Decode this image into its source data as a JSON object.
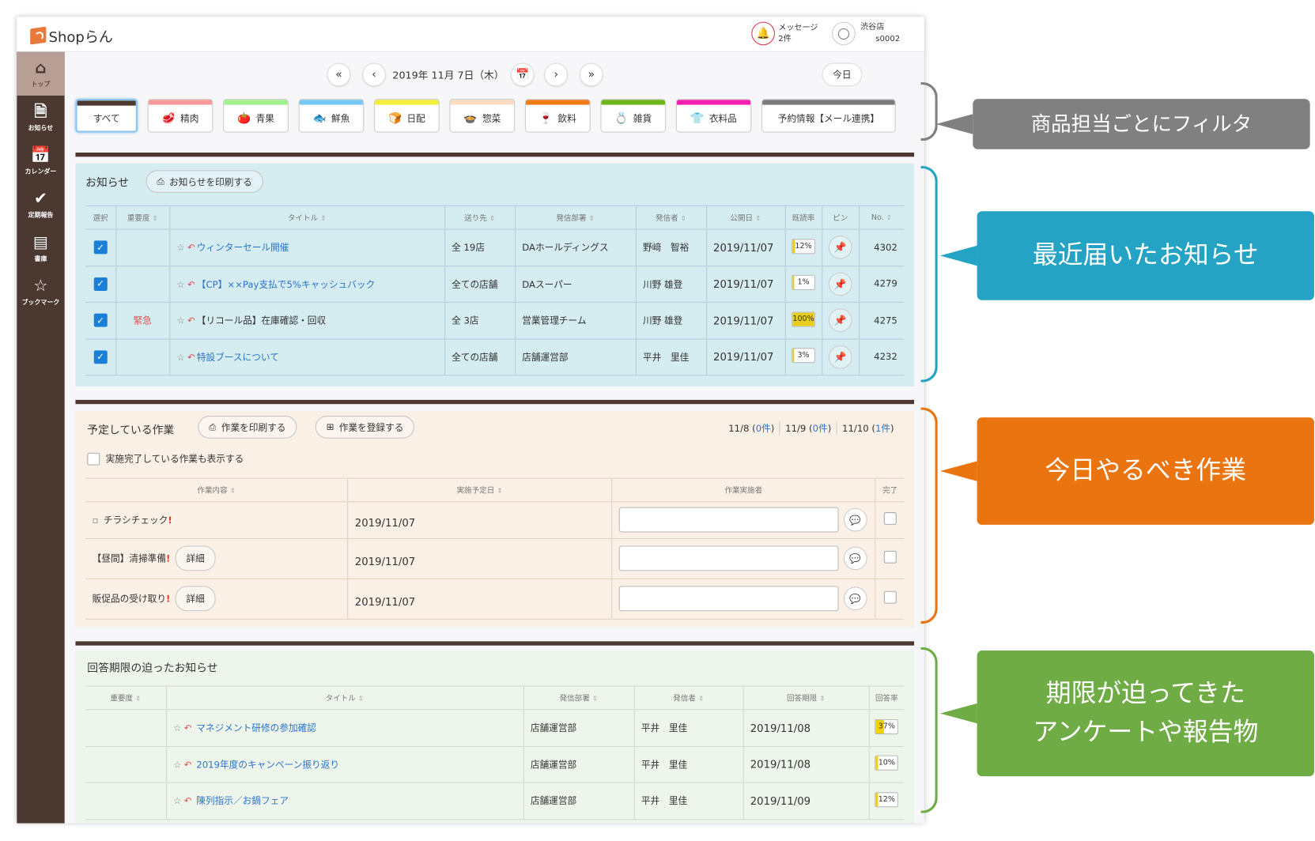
{
  "app": {
    "logo": "Shopらん",
    "message_label": "メッセージ",
    "message_count": "2件",
    "store_name": "渋谷店",
    "store_code": "s0002"
  },
  "sidebar": {
    "items": [
      {
        "label": "トップ",
        "icon": "home-icon"
      },
      {
        "label": "お知らせ",
        "icon": "document-icon"
      },
      {
        "label": "カレンダー",
        "icon": "calendar-icon"
      },
      {
        "label": "定期報告",
        "icon": "check-icon"
      },
      {
        "label": "書庫",
        "icon": "book-icon"
      },
      {
        "label": "ブックマーク",
        "icon": "star-icon"
      }
    ]
  },
  "datenav": {
    "date": "2019年 11月 7日（木）",
    "today": "今日"
  },
  "filters": [
    {
      "label": "すべて",
      "color": "#4a3831",
      "emoji": ""
    },
    {
      "label": "精肉",
      "color": "#f99a9a",
      "emoji": "🥩"
    },
    {
      "label": "青果",
      "color": "#a3f08e",
      "emoji": "🍅"
    },
    {
      "label": "鮮魚",
      "color": "#78c8f5",
      "emoji": "🐟"
    },
    {
      "label": "日配",
      "color": "#f4ee3a",
      "emoji": "🍞"
    },
    {
      "label": "惣菜",
      "color": "#fcdcc0",
      "emoji": "🍲"
    },
    {
      "label": "飲料",
      "color": "#f07a18",
      "emoji": "🍷"
    },
    {
      "label": "雑貨",
      "color": "#6cb81a",
      "emoji": "💍"
    },
    {
      "label": "衣料品",
      "color": "#f020b0",
      "emoji": "👕"
    },
    {
      "label": "予約情報【メール連携】",
      "color": "#7a7a7a",
      "emoji": ""
    }
  ],
  "notices": {
    "title": "お知らせ",
    "print_label": "お知らせを印刷する",
    "columns": [
      "選択",
      "重要度",
      "タイトル",
      "送り先",
      "発信部署",
      "発信者",
      "公開日",
      "既読率",
      "ピン",
      "No."
    ],
    "rows": [
      {
        "importance": "",
        "title": "ウィンターセール開催",
        "dest": "全 19店",
        "dept": "DAホールディングス",
        "sender": "野﨑　智裕",
        "date": "2019/11/07",
        "rate": "12%",
        "rate_value": 12,
        "no": "4302"
      },
      {
        "importance": "",
        "title": "【CP】××Pay支払で5%キャッシュバック",
        "dest": "全ての店舗",
        "dept": "DAスーパー",
        "sender": "川野 雄登",
        "date": "2019/11/07",
        "rate": "1%",
        "rate_value": 1,
        "no": "4279"
      },
      {
        "importance": "緊急",
        "title": "【リコール品】在庫確認・回収",
        "dest": "全 3店",
        "dept": "営業管理チーム",
        "sender": "川野 雄登",
        "date": "2019/11/07",
        "rate": "100%",
        "rate_value": 100,
        "no": "4275"
      },
      {
        "importance": "",
        "title": "特設ブースについて",
        "dest": "全ての店舗",
        "dept": "店舗運営部",
        "sender": "平井　里佳",
        "date": "2019/11/07",
        "rate": "3%",
        "rate_value": 3,
        "no": "4232"
      }
    ]
  },
  "tasks": {
    "title": "予定している作業",
    "print_label": "作業を印刷する",
    "register_label": "作業を登録する",
    "show_done_label": "実施完了している作業も表示する",
    "upcoming": [
      {
        "day": "11/8",
        "count": "0件"
      },
      {
        "day": "11/9",
        "count": "0件"
      },
      {
        "day": "11/10",
        "count": "1件"
      }
    ],
    "columns": [
      "作業内容",
      "実施予定日",
      "作業実施者",
      "完了"
    ],
    "detail_label": "詳細",
    "rows": [
      {
        "name": "チラシチェック",
        "date": "2019/11/07",
        "detail": false
      },
      {
        "name": "【昼間】清掃準備",
        "date": "2019/11/07",
        "detail": true
      },
      {
        "name": "販促品の受け取り",
        "date": "2019/11/07",
        "detail": true
      }
    ]
  },
  "deadlines": {
    "title": "回答期限の迫ったお知らせ",
    "columns": [
      "重要度",
      "タイトル",
      "発信部署",
      "発信者",
      "回答期限",
      "回答率"
    ],
    "rows": [
      {
        "title": "マネジメント研修の参加確認",
        "dept": "店舗運営部",
        "sender": "平井　里佳",
        "due": "2019/11/08",
        "rate": "37%",
        "rate_value": 37
      },
      {
        "title": "2019年度のキャンペーン振り返り",
        "dept": "店舗運営部",
        "sender": "平井　里佳",
        "due": "2019/11/08",
        "rate": "10%",
        "rate_value": 10
      },
      {
        "title": "陳列指示／お鍋フェア",
        "dept": "店舗運営部",
        "sender": "平井　里佳",
        "due": "2019/11/09",
        "rate": "12%",
        "rate_value": 12
      }
    ]
  },
  "callouts": [
    {
      "text": "商品担当ごとにフィルタ",
      "color": "#808080"
    },
    {
      "text": "最近届いたお知らせ",
      "color": "#24a3c5"
    },
    {
      "text": "今日やるべき作業",
      "color": "#ea7410"
    },
    {
      "text": "期限が迫ってきた\nアンケートや報告物",
      "color": "#6fac46"
    }
  ]
}
